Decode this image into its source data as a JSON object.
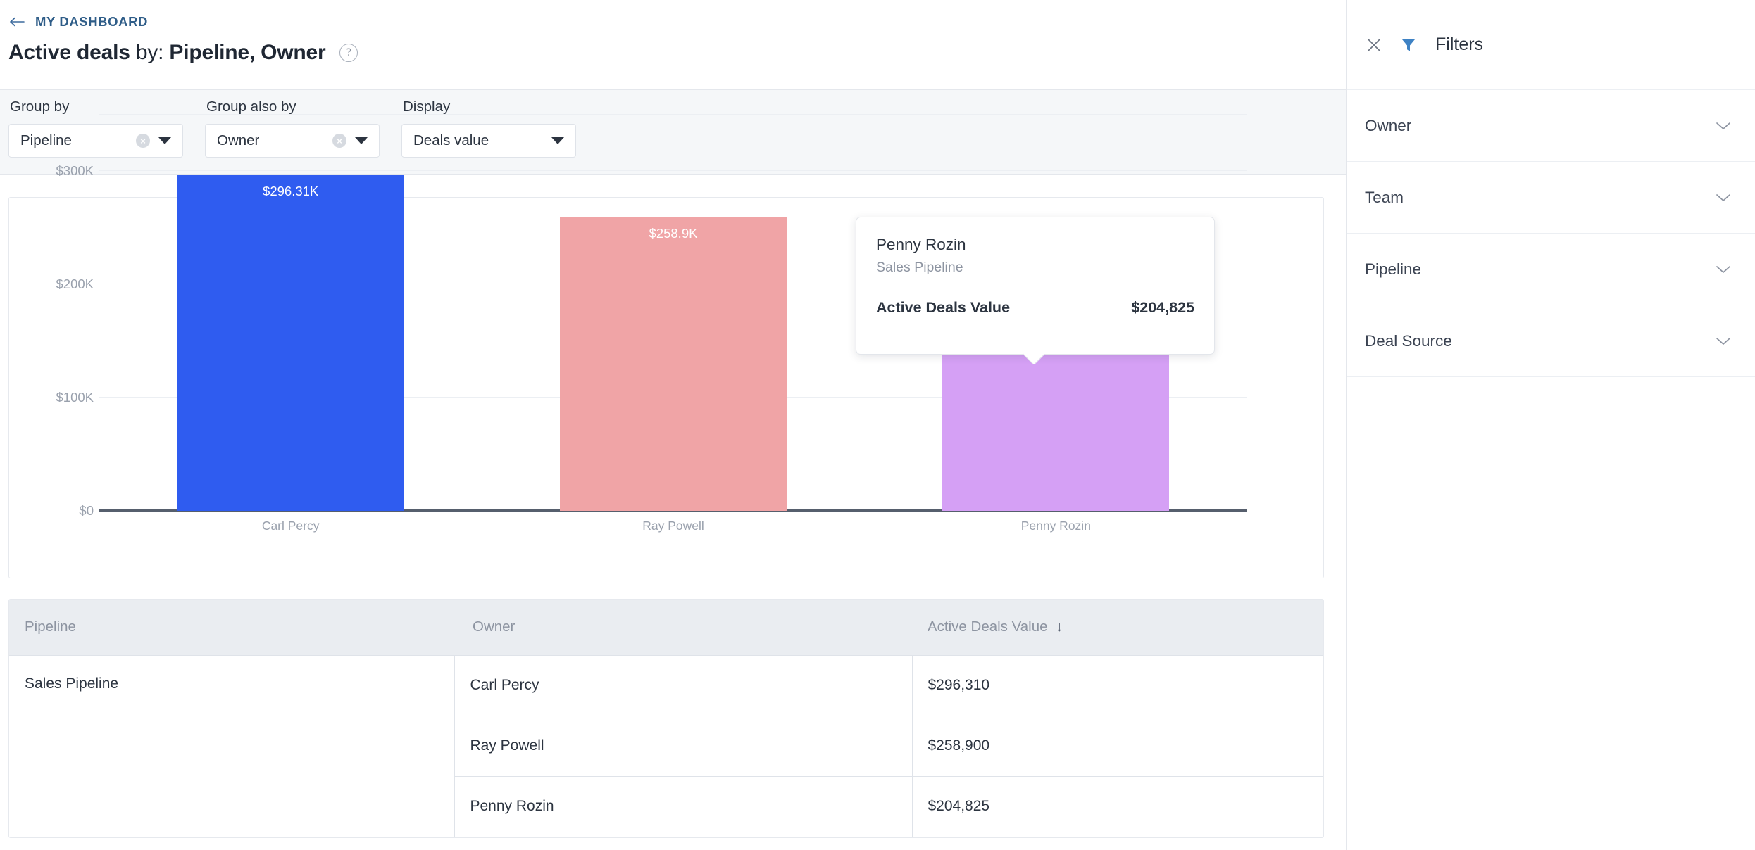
{
  "header": {
    "breadcrumb": "MY DASHBOARD",
    "back_icon": "arrow-left-icon",
    "title_bold_1": "Active deals",
    "title_regular": " by: ",
    "title_bold_2": "Pipeline, Owner",
    "help_icon": "?"
  },
  "controls": [
    {
      "label": "Group by",
      "value": "Pipeline",
      "clearable": true,
      "clear_icon": "×",
      "caret_icon": "chevron-down-icon"
    },
    {
      "label": "Group also by",
      "value": "Owner",
      "clearable": true,
      "clear_icon": "×",
      "caret_icon": "chevron-down-icon"
    },
    {
      "label": "Display",
      "value": "Deals value",
      "clearable": false,
      "clear_icon": "",
      "caret_icon": "chevron-down-icon"
    }
  ],
  "tooltip": {
    "title": "Penny Rozin",
    "subtitle": "Sales Pipeline",
    "metric_label": "Active Deals Value",
    "metric_value": "$204,825"
  },
  "table": {
    "headers": [
      "Pipeline",
      "Owner",
      "Active Deals Value"
    ],
    "sort_indicator": "↓",
    "group_cell": "Sales Pipeline",
    "rows": [
      {
        "owner": "Carl Percy",
        "value": "$296,310"
      },
      {
        "owner": "Ray Powell",
        "value": "$258,900"
      },
      {
        "owner": "Penny Rozin",
        "value": "$204,825"
      }
    ]
  },
  "filters": {
    "title": "Filters",
    "close_icon": "close-icon",
    "funnel_icon": "funnel-icon",
    "items": [
      {
        "label": "Owner",
        "chevron": "chevron-down-icon"
      },
      {
        "label": "Team",
        "chevron": "chevron-down-icon"
      },
      {
        "label": "Pipeline",
        "chevron": "chevron-down-icon"
      },
      {
        "label": "Deal Source",
        "chevron": "chevron-down-icon"
      }
    ]
  },
  "chart_data": {
    "type": "bar",
    "title": "",
    "group_label": "Sales Pipeline",
    "categories": [
      "Carl Percy",
      "Ray Powell",
      "Penny Rozin"
    ],
    "values": [
      296310,
      258900,
      204825
    ],
    "bar_labels": [
      "$296.31K",
      "$258.9K",
      "$204.83K"
    ],
    "colors": [
      "#2f5cf0",
      "#f0a4a6",
      "#d5a0f5"
    ],
    "xlabel": "",
    "ylabel": "",
    "ylim": [
      0,
      350000
    ],
    "yticks": [
      0,
      100000,
      200000,
      300000
    ],
    "ytick_labels": [
      "$0",
      "$100K",
      "$200K",
      "$300K"
    ],
    "grid": true,
    "legend": false
  }
}
